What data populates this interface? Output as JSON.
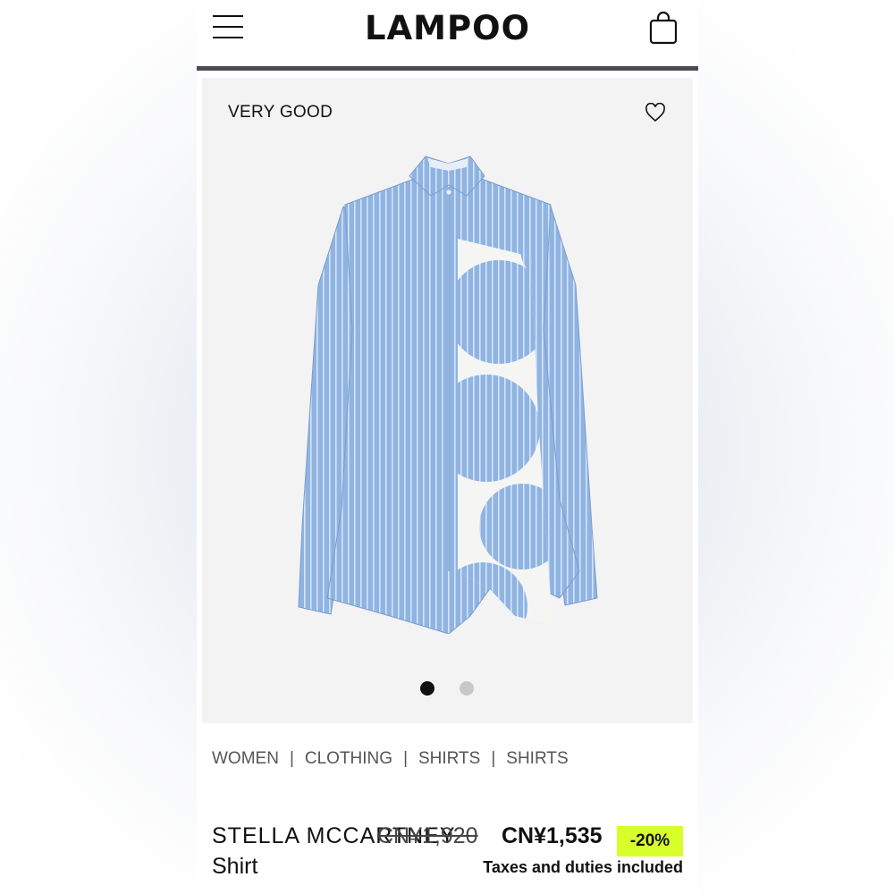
{
  "header": {
    "logo": "LAMPOO",
    "menu_icon": "hamburger-menu-icon",
    "bag_icon": "shopping-bag-icon"
  },
  "product_image": {
    "condition": "VERY GOOD",
    "favorite_icon": "heart-outline-icon",
    "image_count": 2,
    "active_image": 1
  },
  "breadcrumb": [
    "WOMEN",
    "CLOTHING",
    "SHIRTS",
    "SHIRTS"
  ],
  "product": {
    "brand": "STELLA MCCARTNEY",
    "type": "Shirt",
    "original_price": "CN¥1,920",
    "sale_price": "CN¥1,535",
    "discount": "-20%",
    "tax_note": "Taxes and duties included"
  },
  "colors": {
    "discount_badge": "#d8ff2a",
    "header_rule": "#4a4c55",
    "shirt_blue": "#8fb4e2"
  }
}
